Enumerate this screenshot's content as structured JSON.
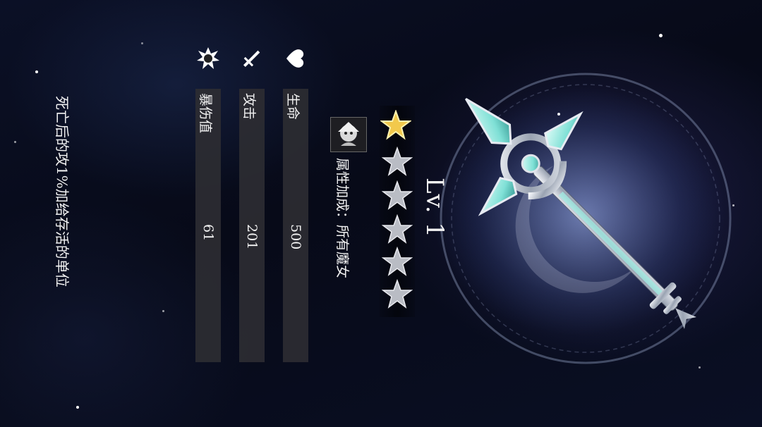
{
  "level_label": "Lv. 1",
  "rarity": {
    "filled": 1,
    "total": 6
  },
  "attribute_bonus": "属性加成：所有魔女",
  "stats": [
    {
      "icon": "heart-icon",
      "label": "生命",
      "value": "500"
    },
    {
      "icon": "sword-icon",
      "label": "攻击",
      "value": "201"
    },
    {
      "icon": "burst-icon",
      "label": "暴伤值",
      "value": "61"
    }
  ],
  "skill_description": "死亡后的攻1%加给存活的单位",
  "colors": {
    "gold_star": "#f2c94c",
    "silver_star": "#b9bcc4",
    "stat_bar": "#2d2d32",
    "staff_crystal": "#8fe9df"
  }
}
